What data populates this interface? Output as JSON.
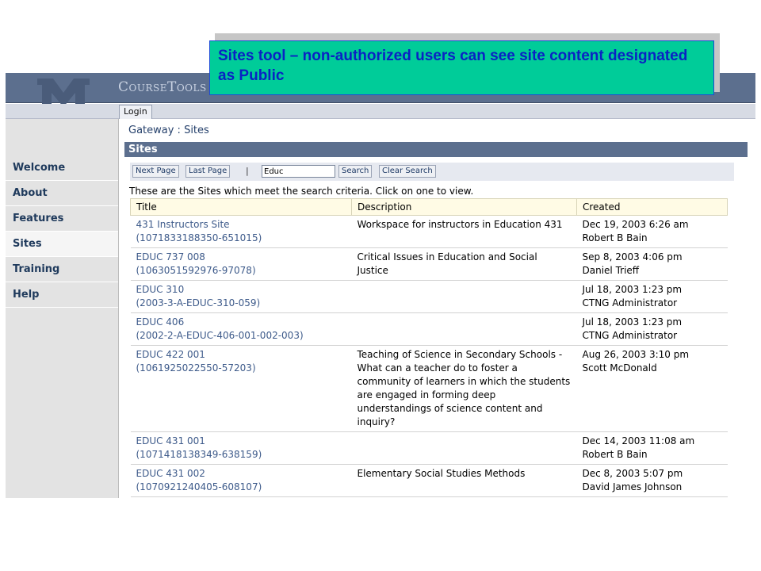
{
  "callout": {
    "text": "Sites tool – non-authorized users can see site content designated as Public"
  },
  "header": {
    "brand": "CourseTools"
  },
  "tabs": {
    "login": "Login"
  },
  "sidebar": {
    "items": [
      {
        "label": "Welcome"
      },
      {
        "label": "About"
      },
      {
        "label": "Features"
      },
      {
        "label": "Sites",
        "active": true
      },
      {
        "label": "Training"
      },
      {
        "label": "Help"
      }
    ]
  },
  "main": {
    "breadcrumb": "Gateway : Sites",
    "panel_title": "Sites",
    "toolbar": {
      "next_page": "Next Page",
      "last_page": "Last Page",
      "separator": "|",
      "search_value": "Educ",
      "search_button": "Search",
      "clear_button": "Clear Search"
    },
    "instructions": "These are the Sites which meet the search criteria. Click on one to view.",
    "table": {
      "headers": [
        "Title",
        "Description",
        "Created"
      ],
      "rows": [
        {
          "title": "431 Instructors Site",
          "id": "(1071833188350-651015)",
          "description": "Workspace for instructors in Education 431",
          "date": "Dec 19, 2003 6:26 am",
          "author": "Robert B Bain"
        },
        {
          "title": "EDUC 737 008",
          "id": "(1063051592976-97078)",
          "description": "Critical Issues in Education and Social Justice",
          "date": "Sep 8, 2003 4:06 pm",
          "author": "Daniel Trieff"
        },
        {
          "title": "EDUC 310",
          "id": "(2003-3-A-EDUC-310-059)",
          "description": "",
          "date": "Jul 18, 2003 1:23 pm",
          "author": "CTNG Administrator"
        },
        {
          "title": "EDUC 406",
          "id": "(2002-2-A-EDUC-406-001-002-003)",
          "description": "",
          "date": "Jul 18, 2003 1:23 pm",
          "author": "CTNG Administrator"
        },
        {
          "title": "EDUC 422 001",
          "id": "(1061925022550-57203)",
          "description": "Teaching of Science in Secondary Schools - What can a teacher do to foster a community of learners in which the students are engaged in forming deep understandings of science content and inquiry?",
          "date": "Aug 26, 2003 3:10 pm",
          "author": "Scott McDonald"
        },
        {
          "title": "EDUC 431 001",
          "id": "(1071418138349-638159)",
          "description": "",
          "date": "Dec 14, 2003 11:08 am",
          "author": "Robert B Bain"
        },
        {
          "title": "EDUC 431 002",
          "id": "(1070921240405-608107)",
          "description": "Elementary Social Studies Methods",
          "date": "Dec 8, 2003 5:07 pm",
          "author": "David James Johnson"
        }
      ]
    }
  },
  "colors": {
    "banner": "#5c6f8e",
    "callout_bg": "#00cc99",
    "callout_text": "#0a22c4",
    "link": "#3d5a8a"
  }
}
